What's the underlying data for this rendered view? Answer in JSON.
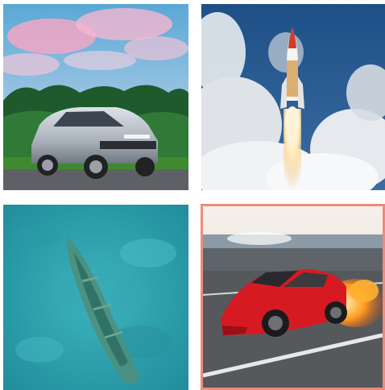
{
  "grid": {
    "tiles": [
      {
        "id": "car",
        "description_icon": "silver-sedan-photo",
        "selected": false
      },
      {
        "id": "rocket",
        "description_icon": "rocket-launch-photo",
        "selected": false
      },
      {
        "id": "boat",
        "description_icon": "sunken-canoe-photo",
        "selected": false
      },
      {
        "id": "supercar",
        "description_icon": "red-supercar-photo",
        "selected": true
      }
    ],
    "selected_border_color": "#ee8b79"
  }
}
